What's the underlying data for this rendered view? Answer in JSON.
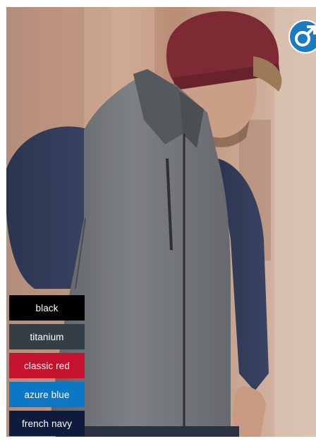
{
  "badge": {
    "icon": "male-symbol-icon",
    "color": "#1a7bc0"
  },
  "color_options": [
    {
      "label": "black",
      "color": "#000000"
    },
    {
      "label": "titanium",
      "color": "#353e47"
    },
    {
      "label": "classic red",
      "color": "#c5122f"
    },
    {
      "label": "azure blue",
      "color": "#0c77c4"
    },
    {
      "label": "french navy",
      "color": "#0f1b3d"
    }
  ]
}
